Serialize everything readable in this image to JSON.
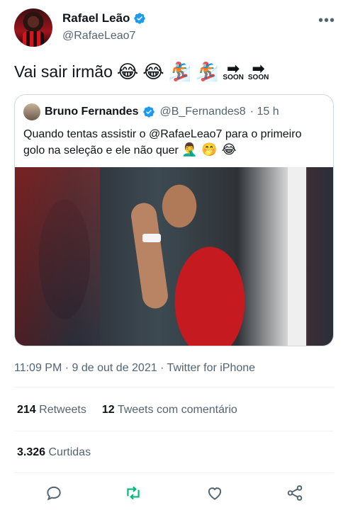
{
  "author": {
    "display_name": "Rafael Leão",
    "handle": "@RafaeLeao7"
  },
  "tweet": {
    "text": "Vai sair irmão",
    "emojis": [
      "😂",
      "😂",
      "🏂",
      "🏂"
    ],
    "soon_label": "SOON"
  },
  "quoted": {
    "display_name": "Bruno Fernandes",
    "handle": "@B_Fernandes8",
    "time": "· 15 h",
    "text": "Quando tentas assistir o @RafaeLeao7 para o primeiro golo na seleção e ele não quer",
    "emojis": "🤦‍♂️ 🤭 😂"
  },
  "meta": {
    "time": "11:09 PM · 9 de out de 2021 · Twitter for iPhone"
  },
  "stats": {
    "retweets_count": "214",
    "retweets_label": "Retweets",
    "quotes_count": "12",
    "quotes_label": "Tweets com comentário",
    "likes_count": "3.326",
    "likes_label": "Curtidas"
  },
  "colors": {
    "verified": "#1d9bf0",
    "secondary_text": "#536471",
    "retweet_green": "#00ba7c"
  },
  "icons": [
    "more-icon",
    "verified-icon",
    "reply-icon",
    "retweet-icon",
    "like-icon",
    "share-icon"
  ]
}
